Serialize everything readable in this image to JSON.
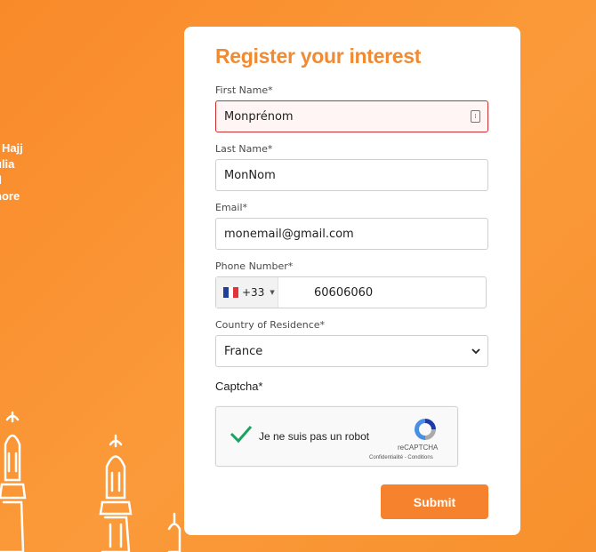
{
  "background_text": [
    "f Hajj",
    "ulia",
    "d",
    "nore"
  ],
  "form": {
    "title": "Register your interest",
    "first_name": {
      "label": "First Name*",
      "value": "Monprénom"
    },
    "last_name": {
      "label": "Last Name*",
      "value": "MonNom"
    },
    "email": {
      "label": "Email*",
      "value": "monemail@gmail.com"
    },
    "phone": {
      "label": "Phone Number*",
      "country_code": "+33",
      "value": "60606060"
    },
    "country": {
      "label": "Country of Residence*",
      "selected": "France"
    },
    "captcha": {
      "label": "Captcha*",
      "text": "Je ne suis pas un robot",
      "brand": "reCAPTCHA",
      "links": "Confidentialité - Conditions",
      "checked": true
    },
    "submit_label": "Submit"
  },
  "colors": {
    "accent": "#f7822d",
    "title": "#f08a33",
    "error_border": "#c8312f",
    "check_green": "#1aa260"
  }
}
